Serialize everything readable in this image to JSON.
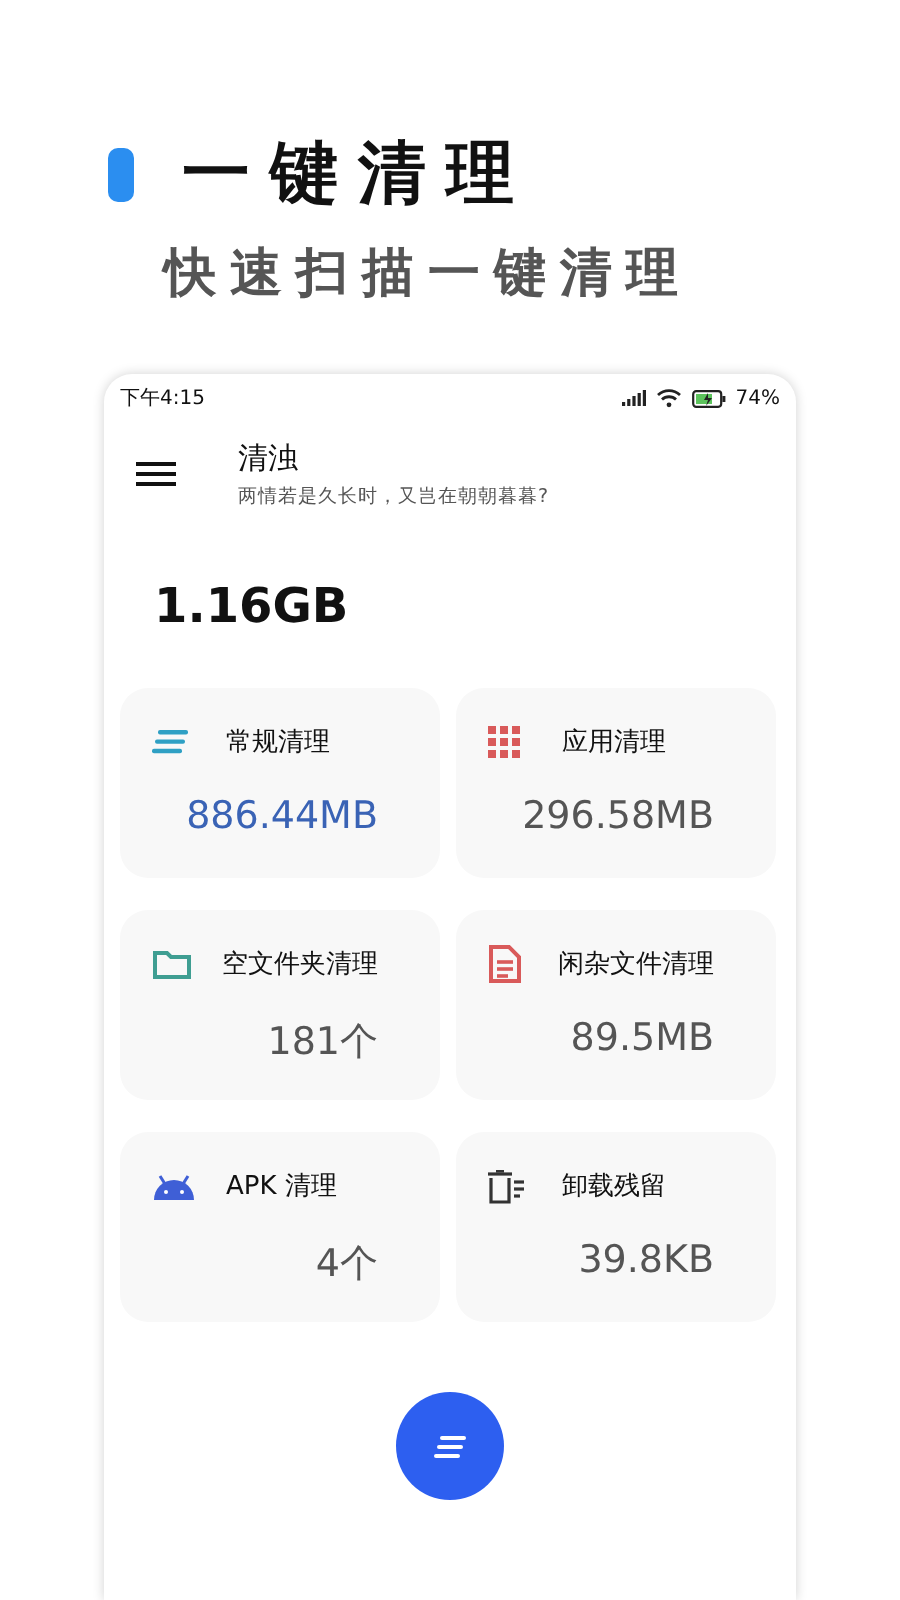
{
  "promo": {
    "title": "一键清理",
    "subtitle": "快速扫描一键清理"
  },
  "status_bar": {
    "time": "下午4:15",
    "battery": "74%"
  },
  "app_bar": {
    "title": "清浊",
    "subtitle": "两情若是久长时，又岂在朝朝暮暮?"
  },
  "total": "1.16GB",
  "cards": [
    {
      "kind": "general",
      "title": "常规清理",
      "value": "886.44MB",
      "highlighted": true
    },
    {
      "kind": "apps",
      "title": "应用清理",
      "value": "296.58MB",
      "highlighted": false
    },
    {
      "kind": "folder",
      "title": "空文件夹清理",
      "value": "181个",
      "highlighted": false
    },
    {
      "kind": "file",
      "title": "闲杂文件清理",
      "value": "89.5MB",
      "highlighted": false
    },
    {
      "kind": "apk",
      "title": "APK 清理",
      "value": "4个",
      "highlighted": false
    },
    {
      "kind": "residue",
      "title": "卸载残留",
      "value": "39.8KB",
      "highlighted": false
    }
  ]
}
